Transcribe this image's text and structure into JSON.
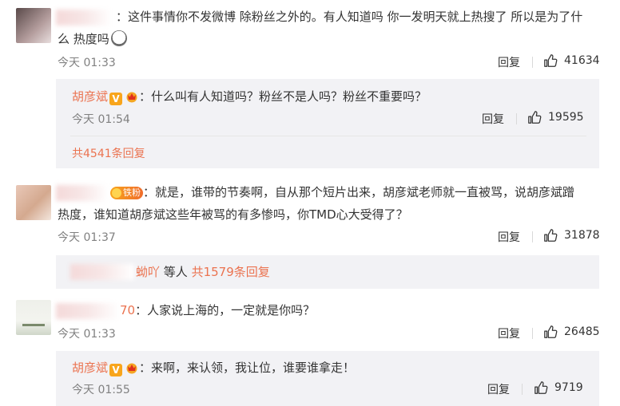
{
  "comments": [
    {
      "text": "：这件事情你不发微博 除粉丝之外的。有人知道吗 你一发明天就上热搜了 所以是为了什",
      "text_line2": "么 热度吗",
      "time": "今天 01:33",
      "reply_label": "回复",
      "likes": "41634",
      "replies": [
        {
          "user": "胡彦斌",
          "text": "：什么叫有人知道吗？粉丝不是人吗？粉丝不重要吗？",
          "time": "今天 01:54",
          "reply_label": "回复",
          "likes": "19595"
        }
      ],
      "more": "共4541条回复"
    },
    {
      "badge_text": "铁粉",
      "text": "：就是，谁带的节奏啊，自从那个短片出来，胡彦斌老师就一直被骂，说胡彦斌蹭",
      "text_line2": "热度，谁知道胡彦斌这些年被骂的有多惨吗，你TMD心大受得了？",
      "time": "今天 01:37",
      "reply_label": "回复",
      "likes": "31878",
      "summary_name_tail": "蚴吖",
      "summary_mid": " 等人 ",
      "summary_count": "共1579条回复"
    },
    {
      "user_tail": "70",
      "text": "：人家说上海的，一定就是你吗？",
      "time": "今天 01:33",
      "reply_label": "回复",
      "likes": "26485",
      "replies": [
        {
          "user": "胡彦斌",
          "text": "：来啊，来认领，我让位，谁要谁拿走！",
          "time": "今天 01:55",
          "reply_label": "回复",
          "likes": "9719"
        }
      ]
    }
  ],
  "badges": {
    "verified": "V"
  },
  "icons": {
    "like": "thumbs-up-icon",
    "crown": "fan-crown-icon",
    "emoji": "surprised-emoji-icon"
  },
  "colors": {
    "accent": "#eb7350",
    "reply_bg": "#f2f2f5",
    "meta": "#808080"
  }
}
